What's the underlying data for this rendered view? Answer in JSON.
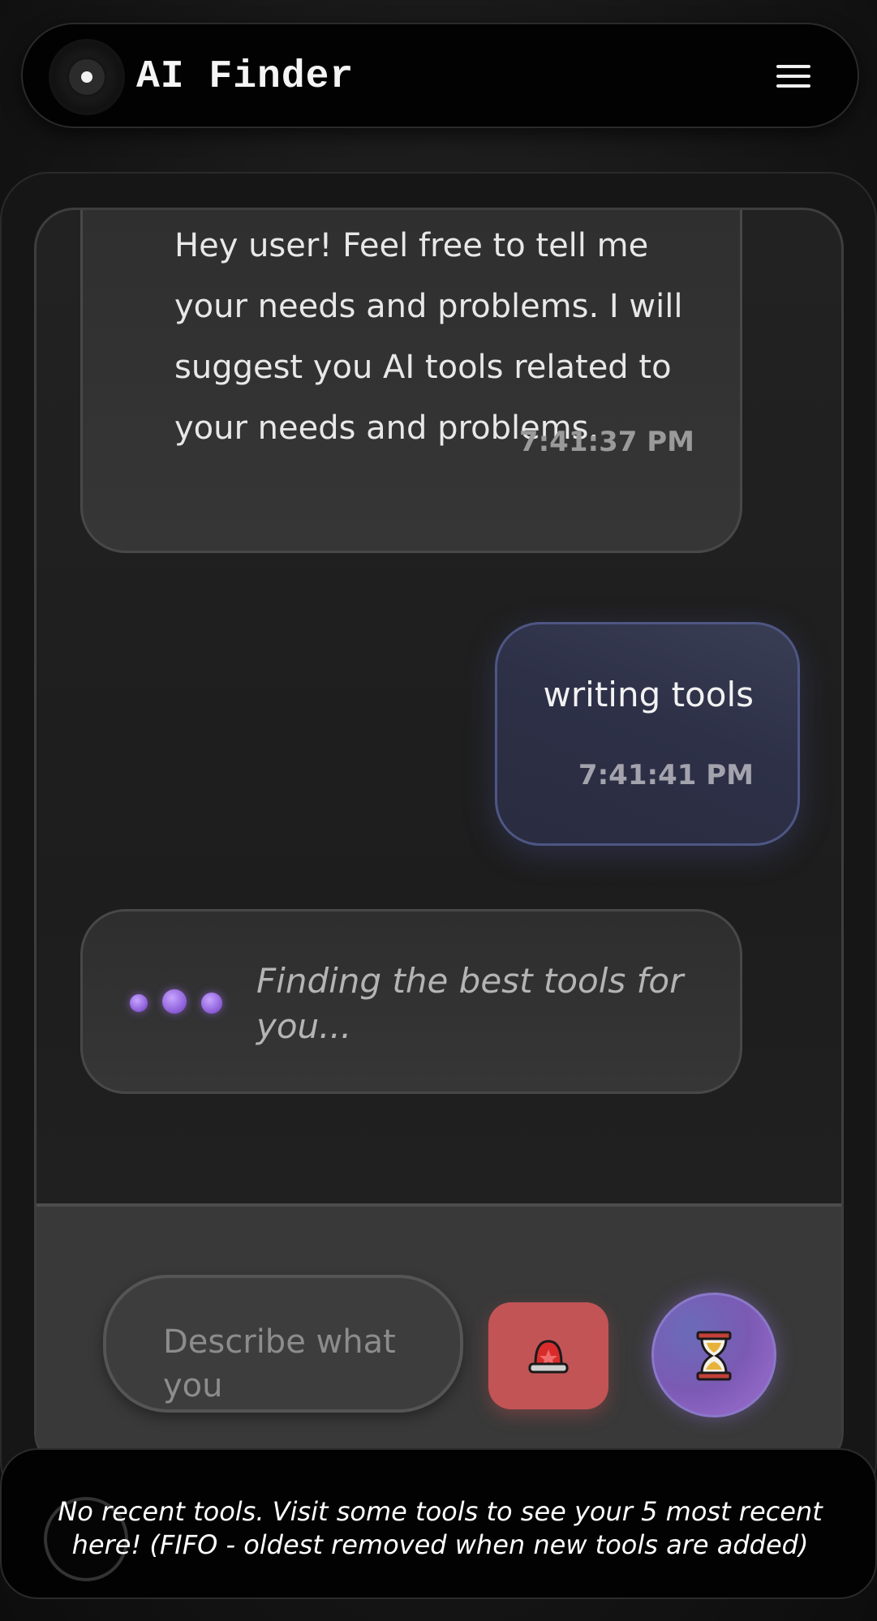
{
  "header": {
    "title": "AI Finder",
    "logo_icon": "logo-dot-icon",
    "menu_icon": "hamburger-menu-icon"
  },
  "messages": [
    {
      "role": "bot",
      "text": "Hey user! Feel free to tell me your needs and problems. I will suggest you AI tools related to your needs and problems.",
      "time": "7:41:37 PM"
    },
    {
      "role": "user",
      "text": "writing tools",
      "time": "7:41:41 PM"
    }
  ],
  "typing": {
    "text": "Finding the best tools for you..."
  },
  "input": {
    "placeholder": "Describe what you",
    "value": ""
  },
  "buttons": {
    "stop_icon": "siren-icon",
    "send_icon": "hourglass-icon"
  },
  "recent_tools": {
    "empty_text": "No recent tools. Visit some tools to see your 5 most recent here! (FIFO - oldest removed when new tools are added)"
  },
  "colors": {
    "background": "#161616",
    "user_bubble_border": "#4e5684",
    "stop_button": "#c25456",
    "send_button": "#7b5ab4",
    "typing_dot": "#a06fd0"
  }
}
